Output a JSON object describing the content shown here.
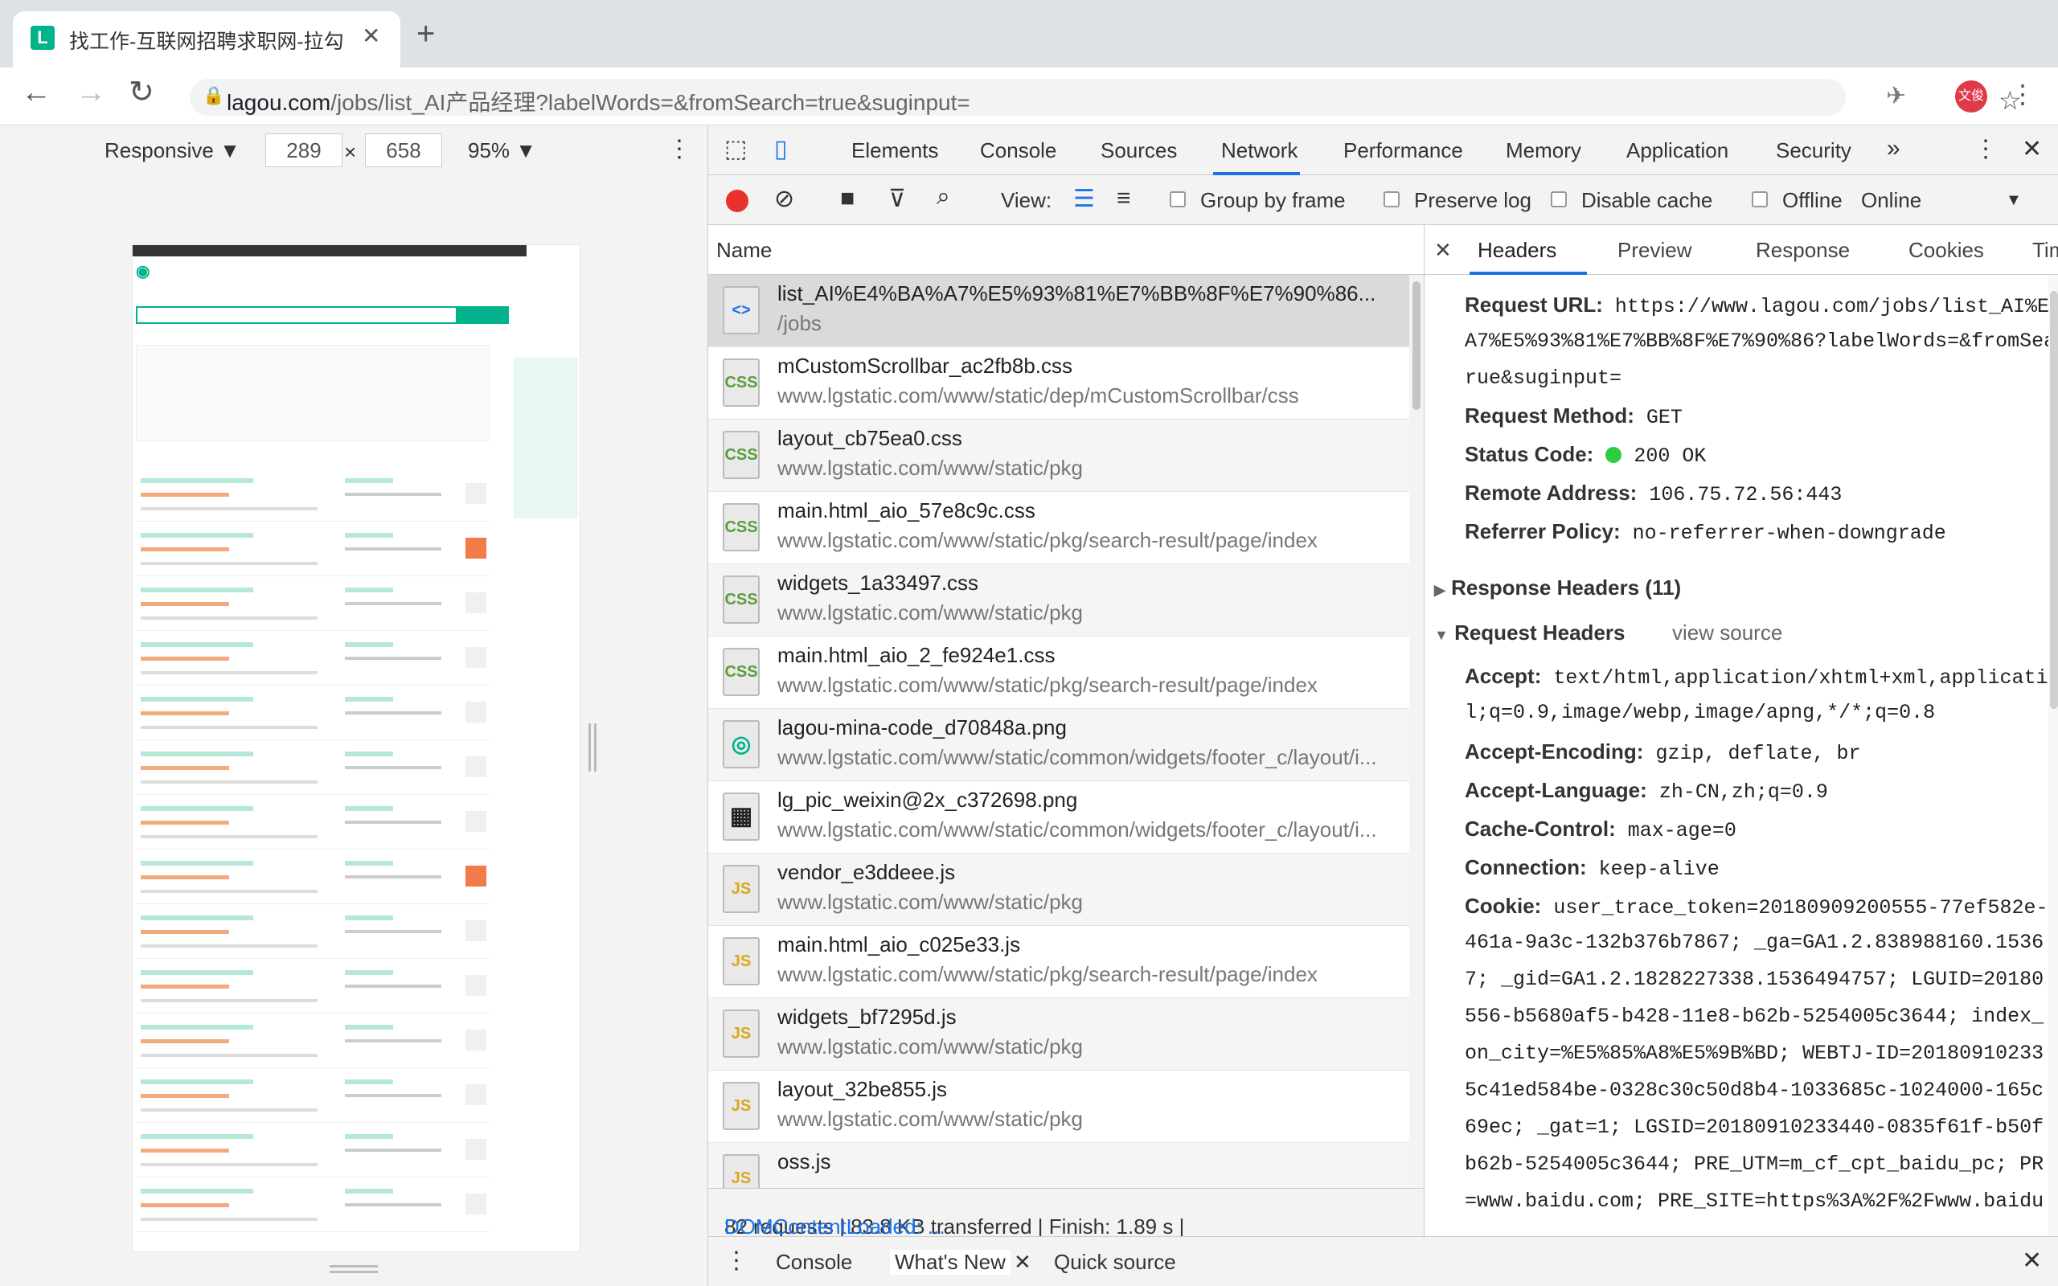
{
  "browser": {
    "tab_title": "找工作-互联网招聘求职网-拉勾",
    "favicon_letter": "L",
    "url_host": "lagou.com",
    "url_rest": "/jobs/list_AI产品经理?labelWords=&fromSearch=true&suginput=",
    "avatar_text": "文俊"
  },
  "device_toolbar": {
    "mode": "Responsive ▼",
    "width": "289",
    "times": "×",
    "height": "658",
    "zoom": "95% ▼"
  },
  "devtools": {
    "tabs": [
      "Elements",
      "Console",
      "Sources",
      "Network",
      "Performance",
      "Memory",
      "Application",
      "Security"
    ],
    "more": "»",
    "network_toolbar": {
      "view_label": "View:",
      "group_by_frame": "Group by frame",
      "preserve_log": "Preserve log",
      "disable_cache": "Disable cache",
      "offline": "Offline",
      "throttle": "Online"
    },
    "name_header": "Name",
    "requests": [
      {
        "name": "list_AI%E4%BA%A7%E5%93%81%E7%BB%8F%E7%90%86...",
        "path": "/jobs",
        "icon": "<>"
      },
      {
        "name": "mCustomScrollbar_ac2fb8b.css",
        "path": "www.lgstatic.com/www/static/dep/mCustomScrollbar/css",
        "icon": "CSS"
      },
      {
        "name": "layout_cb75ea0.css",
        "path": "www.lgstatic.com/www/static/pkg",
        "icon": "CSS"
      },
      {
        "name": "main.html_aio_57e8c9c.css",
        "path": "www.lgstatic.com/www/static/pkg/search-result/page/index",
        "icon": "CSS"
      },
      {
        "name": "widgets_1a33497.css",
        "path": "www.lgstatic.com/www/static/pkg",
        "icon": "CSS"
      },
      {
        "name": "main.html_aio_2_fe924e1.css",
        "path": "www.lgstatic.com/www/static/pkg/search-result/page/index",
        "icon": "CSS"
      },
      {
        "name": "lagou-mina-code_d70848a.png",
        "path": "www.lgstatic.com/www/static/common/widgets/footer_c/layout/i...",
        "icon": "◎"
      },
      {
        "name": "lg_pic_weixin@2x_c372698.png",
        "path": "www.lgstatic.com/www/static/common/widgets/footer_c/layout/i...",
        "icon": "▦"
      },
      {
        "name": "vendor_e3ddeee.js",
        "path": "www.lgstatic.com/www/static/pkg",
        "icon": "JS"
      },
      {
        "name": "main.html_aio_c025e33.js",
        "path": "www.lgstatic.com/www/static/pkg/search-result/page/index",
        "icon": "JS"
      },
      {
        "name": "widgets_bf7295d.js",
        "path": "www.lgstatic.com/www/static/pkg",
        "icon": "JS"
      },
      {
        "name": "layout_32be855.js",
        "path": "www.lgstatic.com/www/static/pkg",
        "icon": "JS"
      },
      {
        "name": "oss.js",
        "path": "",
        "icon": "JS"
      }
    ],
    "summary": {
      "text": "82 requests | 83.8 KB transferred | Finish: 1.89 s | ",
      "dom": "DOMContentLoaded: ..."
    },
    "detail_tabs": [
      "Headers",
      "Preview",
      "Response",
      "Cookies",
      "Timing"
    ],
    "general": [
      {
        "k": "Request URL:",
        "v": "https://www.lagou.com/jobs/list_AI%E"
      },
      {
        "k": "",
        "v": "A7%E5%93%81%E7%BB%8F%E7%90%86?labelWords=&fromSea"
      },
      {
        "k": "",
        "v": "rue&suginput="
      },
      {
        "k": "Request Method:",
        "v": "GET"
      },
      {
        "k": "Status Code:",
        "v": "200 OK"
      },
      {
        "k": "Remote Address:",
        "v": "106.75.72.56:443"
      },
      {
        "k": "Referrer Policy:",
        "v": "no-referrer-when-downgrade"
      }
    ],
    "response_headers": "Response Headers (11)",
    "request_headers": "Request Headers",
    "view_source": "view source",
    "req_headers": [
      {
        "k": "Accept:",
        "v": "text/html,application/xhtml+xml,applicati"
      },
      {
        "k": "",
        "v": "l;q=0.9,image/webp,image/apng,*/*;q=0.8"
      },
      {
        "k": "Accept-Encoding:",
        "v": "gzip, deflate, br"
      },
      {
        "k": "Accept-Language:",
        "v": "zh-CN,zh;q=0.9"
      },
      {
        "k": "Cache-Control:",
        "v": "max-age=0"
      },
      {
        "k": "Connection:",
        "v": "keep-alive"
      },
      {
        "k": "Cookie:",
        "v": "user_trace_token=20180909200555-77ef582e-"
      },
      {
        "k": "",
        "v": "461a-9a3c-132b376b7867; _ga=GA1.2.838988160.1536"
      },
      {
        "k": "",
        "v": "7; _gid=GA1.2.1828227338.1536494757; LGUID=20180"
      },
      {
        "k": "",
        "v": "556-b5680af5-b428-11e8-b62b-5254005c3644; index_"
      },
      {
        "k": "",
        "v": "on_city=%E5%85%A8%E5%9B%BD; WEBTJ-ID=20180910233"
      },
      {
        "k": "",
        "v": "5c41ed584be-0328c30c50d8b4-1033685c-1024000-165c"
      },
      {
        "k": "",
        "v": "69ec; _gat=1; LGSID=20180910233440-0835f61f-b50f"
      },
      {
        "k": "",
        "v": "b62b-5254005c3644; PRE_UTM=m_cf_cpt_baidu_pc; PR"
      },
      {
        "k": "",
        "v": "=www.baidu.com; PRE_SITE=https%3A%2F%2Fwww.baidu"
      }
    ],
    "drawer": [
      "Console",
      "What's New",
      "Quick source"
    ],
    "colors": {
      "accent": "#1a73e8",
      "record": "#e8302f",
      "status_ok": "#2ecc40",
      "brand": "#00b38a"
    }
  }
}
